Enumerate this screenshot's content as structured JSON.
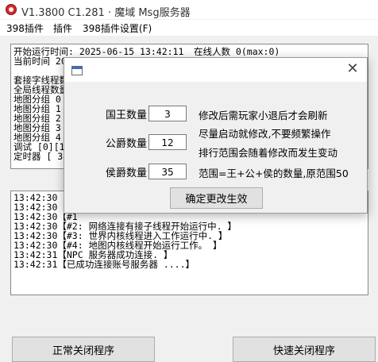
{
  "window": {
    "title": "V1.3800 C1.281 · 魔域 Msg服务器"
  },
  "menu": {
    "items": [
      "398插件",
      "插件",
      "398插件设置(F)"
    ]
  },
  "status": {
    "line1_left": "开始运行时间:  2025-06-15 13:42:11",
    "line1_right": "在线人数   0(max:0)",
    "line2": "当前时间  202",
    "line3": "套接字线程数",
    "line4": "全局线程数量",
    "line5": "地图分组 0",
    "line6": "地图分组 1",
    "line7": "地图分组 2",
    "line8": "地图分组 3",
    "line9": "地图分组 4",
    "line10": "调试 [0][1]",
    "line11": "定时器  [ 34"
  },
  "log": {
    "lines": [
      "13:42:30【初",
      "13:42:30【服",
      "13:42:30【#1",
      "13:42:30【#2: 网络连接有接子线程开始运行中. 】",
      "13:42:30【#3: 世界内核线程进入工作运行中. 】",
      "13:42:30【#4: 地图内核线程开始运行工作。        】",
      "13:42:31【NPC 服务器成功连接. 】",
      "13:42:31【已成功连接账号服务器 ....】"
    ]
  },
  "buttons": {
    "normal_close": "正常关闭程序",
    "fast_close": "快速关闭程序"
  },
  "dialog": {
    "close_glyph": "✕",
    "fields": [
      {
        "label": "国王数量",
        "value": "3",
        "note": "修改后需玩家小退后才会刷新"
      },
      {
        "label": "公爵数量",
        "value": "12",
        "note": "尽量启动就修改,不要频繁操作"
      },
      {
        "label": "侯爵数量",
        "value": "35",
        "note": "范围=王+公+侯的数量,原范围50"
      }
    ],
    "extra_note": "排行范围会随着修改而发生变动",
    "apply_label": "确定更改生效"
  }
}
